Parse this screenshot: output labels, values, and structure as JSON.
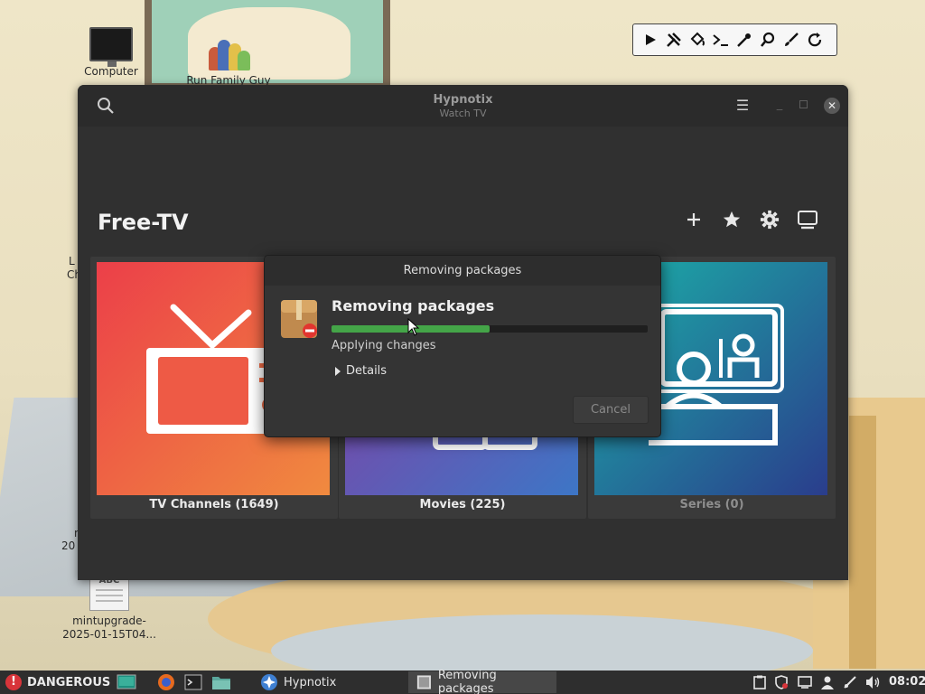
{
  "desktop": {
    "icons": [
      {
        "label": "Computer"
      },
      {
        "label": "Run Family Guy"
      },
      {
        "label": "mintupgrade-\n2025-01-15T04..."
      }
    ],
    "partial_labels": [
      "L",
      "Ch",
      "n",
      "20"
    ]
  },
  "toolbar": {
    "tools": [
      "play-icon",
      "tools-icon",
      "paint-bucket-icon",
      "terminal-prompt-icon",
      "eyedropper-icon",
      "magnifier-icon",
      "brush-icon",
      "refresh-icon"
    ]
  },
  "app": {
    "title": "Hypnotix",
    "subtitle": "Watch TV",
    "heading": "Free-TV",
    "tiles": [
      {
        "caption": "TV Channels (1649)",
        "colors": [
          "#ec3f49",
          "#f08a3f"
        ]
      },
      {
        "caption": "Movies (225)",
        "colors": [
          "#8a3aa0",
          "#3d76c6"
        ]
      },
      {
        "caption": "Series (0)",
        "colors": [
          "#1bb0a8",
          "#2a3d8c"
        ]
      }
    ]
  },
  "dialog": {
    "title": "Removing packages",
    "heading": "Removing packages",
    "progress": 0.5,
    "status": "Applying changes",
    "details_label": "Details",
    "cancel_label": "Cancel"
  },
  "taskbar": {
    "warning_label": "DANGEROUS",
    "tasks": [
      {
        "label": "Hypnotix",
        "active": false
      },
      {
        "label": "Removing packages",
        "active": true
      }
    ],
    "clock": "08:02"
  },
  "colors": {
    "accent_green": "#44a548",
    "danger_red": "#d8343a",
    "window_bg": "#303030"
  }
}
